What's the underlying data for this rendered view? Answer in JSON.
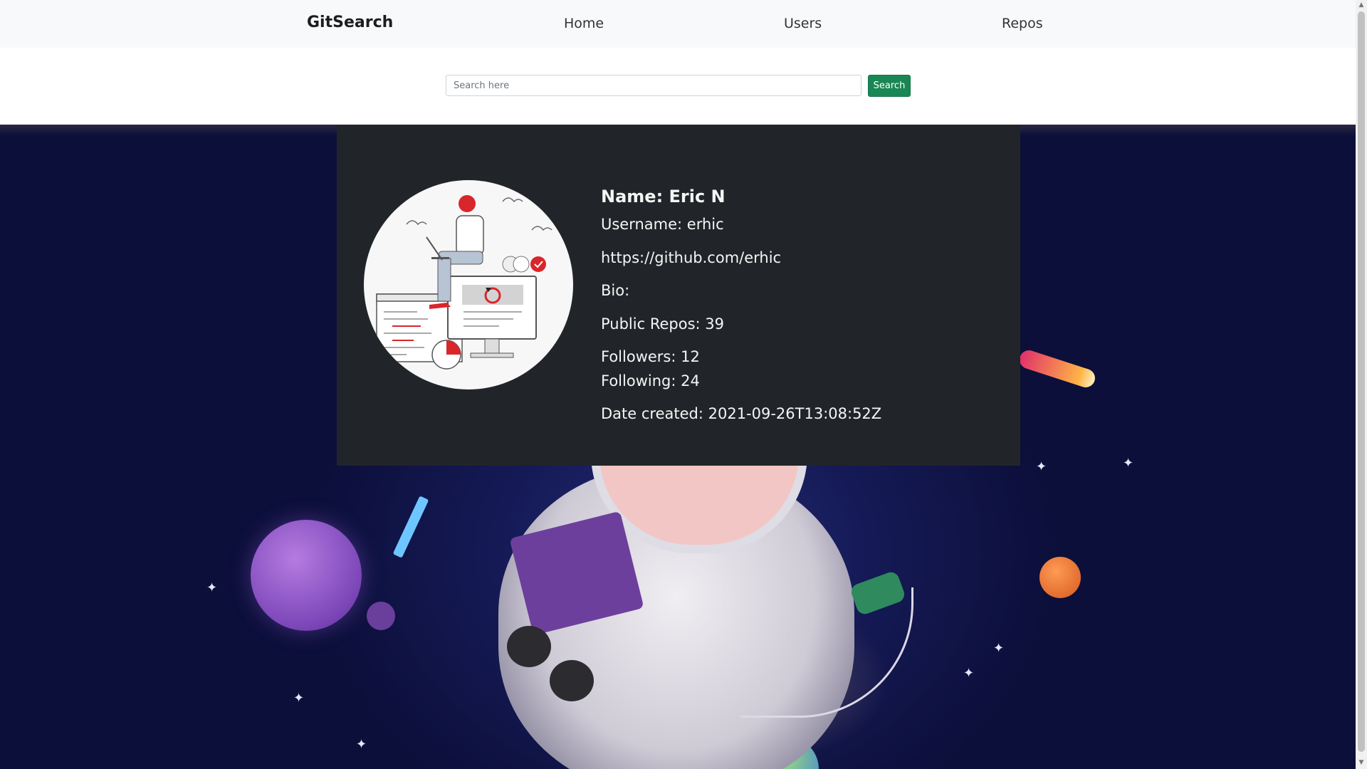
{
  "navbar": {
    "brand": "GitSearch",
    "links": [
      "Home",
      "Users",
      "Repos"
    ]
  },
  "search": {
    "placeholder": "Search here",
    "value": "",
    "button_label": "Search",
    "button_color": "#198754"
  },
  "profile": {
    "avatar_icon": "developer-illustration-icon",
    "name": "Name: Eric N",
    "username": "Username: erhic",
    "url": "https://github.com/erhic",
    "bio": "Bio:",
    "public_repos": "Public Repos: 39",
    "followers": "Followers: 12",
    "following": "Following: 24",
    "date_created": "Date created: 2021-09-26T13:08:52Z"
  },
  "colors": {
    "card_background": "#212529",
    "navbar_background": "#f8f9fa"
  }
}
